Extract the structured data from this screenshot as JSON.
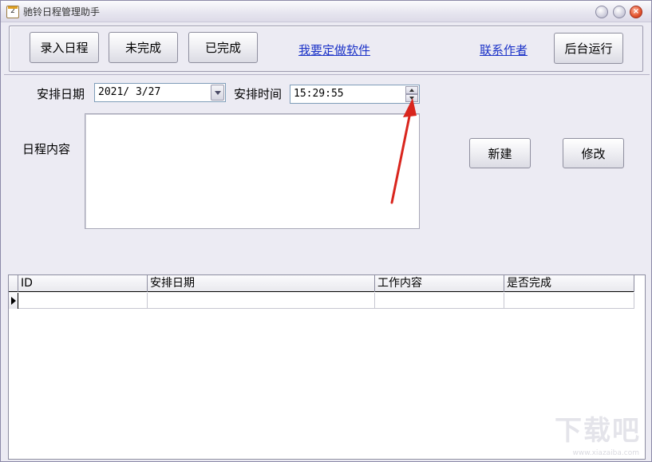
{
  "window": {
    "title": "驰铃日程管理助手",
    "app_icon_text": "2",
    "close_glyph": "×"
  },
  "toolbar": {
    "enter_schedule": "录入日程",
    "not_completed": "未完成",
    "completed": "已完成",
    "custom_software_link": "我要定做软件",
    "contact_author_link": "联系作者",
    "run_background": "后台运行"
  },
  "form": {
    "date_label": "安排日期",
    "date_value": "2021/ 3/27",
    "time_label": "安排时间",
    "time_value": "15:29:55",
    "content_label": "日程内容",
    "content_value": "",
    "new_button": "新建",
    "modify_button": "修改"
  },
  "grid": {
    "columns": [
      "ID",
      "安排日期",
      "工作内容",
      "是否完成"
    ],
    "rows": [
      {
        "id": "",
        "date": "",
        "content": "",
        "done": ""
      }
    ]
  },
  "watermark": {
    "text": "下载吧",
    "url": "www.xiazaiba.com"
  },
  "colors": {
    "link": "#1c33c8",
    "annotation_arrow": "#d9251d",
    "window_bg": "#ecebf3"
  }
}
